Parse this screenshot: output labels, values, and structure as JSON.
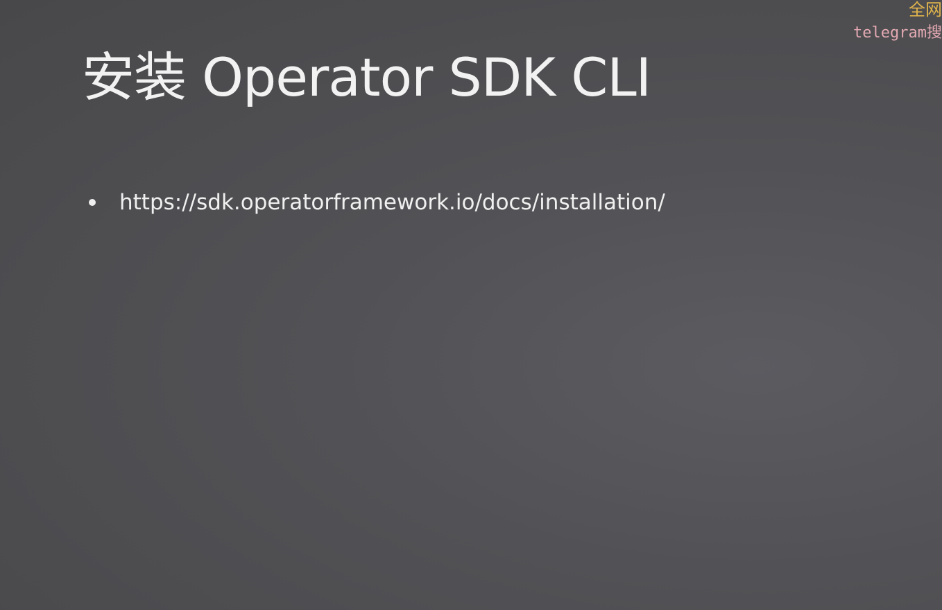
{
  "slide": {
    "title": "安装 Operator SDK CLI",
    "bullets": [
      "https://sdk.operatorframework.io/docs/installation/"
    ]
  },
  "watermark": {
    "line1": "全网",
    "line2": "telegram搜"
  },
  "colors": {
    "background": "#4f4f52",
    "text": "#f2f2f2",
    "watermark_line1": "#e0b44c",
    "watermark_line2": "#e3a9b2"
  }
}
